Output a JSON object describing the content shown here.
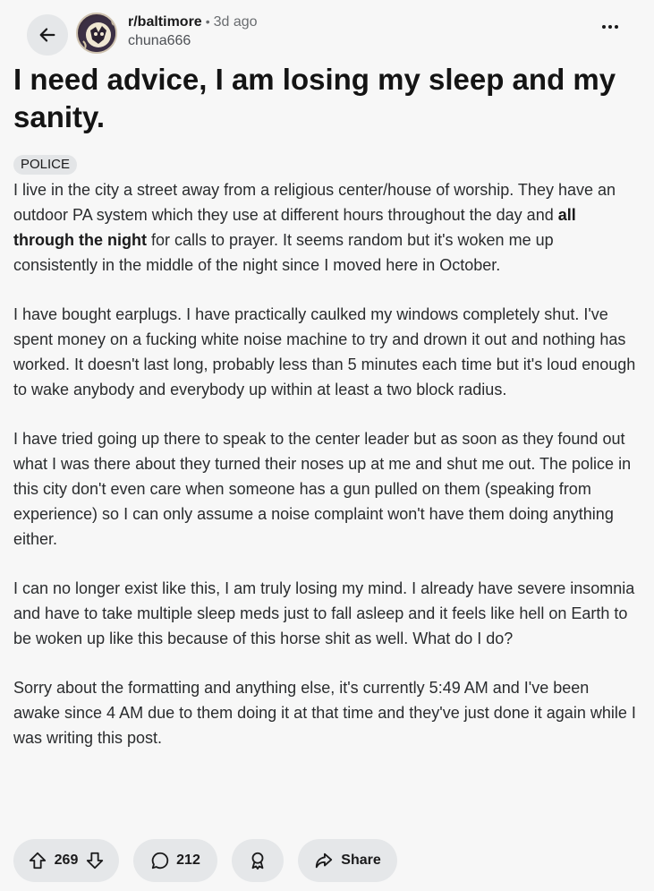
{
  "header": {
    "subreddit": "r/baltimore",
    "separator": "•",
    "time": "3d ago",
    "author": "chuna666"
  },
  "post": {
    "title": "I need advice, I am losing my sleep and my sanity.",
    "flair": "POLICE",
    "paragraphs": [
      {
        "before": "I live in the city a street away from a religious center/house of worship. They have an outdoor PA system which they use at different hours throughout the day and ",
        "bold": "all through the night",
        "after": " for calls to prayer. It seems random but it's woken me up consistently in the middle of the night since I moved here in October."
      },
      "I have bought earplugs. I have practically caulked my windows completely shut. I've spent money on a fucking white noise machine to try and drown it out and nothing has worked. It doesn't last long, probably less than 5 minutes each time but it's loud enough to wake anybody and everybody up within at least a two block radius.",
      "I have tried going up there to speak to the center leader but as soon as they found out what I was there about they turned their noses up at me and shut me out. The police in this city don't even care when someone has a gun pulled on them (speaking from experience) so I can only assume a noise complaint won't have them doing anything either.",
      "I can no longer exist like this, I am truly losing my mind. I already have severe insomnia and have to take multiple sleep meds just to fall asleep and it feels like hell on Earth to be woken up like this because of this horse shit as well. What do I do?",
      "Sorry about the formatting and anything else, it's currently 5:49 AM and I've been awake since 4 AM due to them doing it at that time and they've just done it again while I was writing this post."
    ]
  },
  "actions": {
    "votes": "269",
    "comments": "212",
    "share_label": "Share"
  },
  "icons": {
    "back": "arrow-left-icon",
    "more": "more-horizontal-icon",
    "upvote": "arrow-up-icon",
    "downvote": "arrow-down-icon",
    "comment": "comment-bubble-icon",
    "award": "award-icon",
    "share": "share-arrow-icon"
  }
}
